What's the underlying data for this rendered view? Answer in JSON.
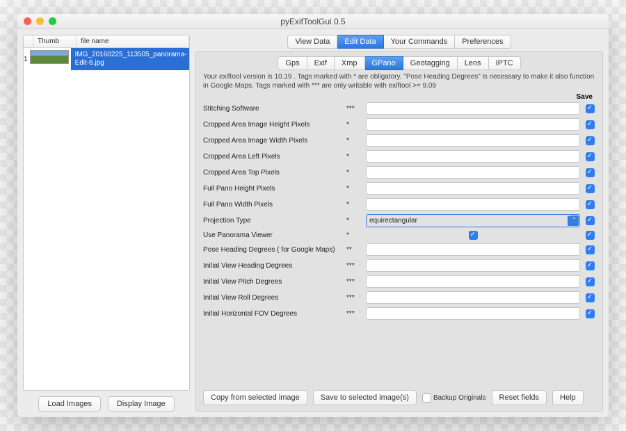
{
  "window": {
    "title": "pyExifToolGui 0.5"
  },
  "filelist": {
    "headers": {
      "thumb": "Thumb",
      "filename": "file name"
    },
    "rows": [
      {
        "index": "1",
        "filename": "IMG_20160225_113505_panorama-Edit-6.jpg"
      }
    ]
  },
  "left_buttons": {
    "load": "Load Images",
    "display": "Display Image"
  },
  "main_tabs": [
    "View Data",
    "Edit Data",
    "Your Commands",
    "Preferences"
  ],
  "main_tab_active": 1,
  "sub_tabs": [
    "Gps",
    "Exif",
    "Xmp",
    "GPano",
    "Geotagging",
    "Lens",
    "IPTC"
  ],
  "sub_tab_active": 3,
  "info_text": "Your exiftool version is 10.19 . Tags marked with * are obligatory. \"Pose Heading Degrees\" is necessary to make it also function in Google Maps. Tags marked with *** are only writable with exiftool >= 9.09",
  "save_header": "Save",
  "fields": [
    {
      "label": "Stitching Software",
      "ast": "***",
      "type": "text",
      "value": "",
      "save": true
    },
    {
      "label": "Cropped Area Image Height Pixels",
      "ast": "*",
      "type": "text",
      "value": "",
      "save": true
    },
    {
      "label": "Cropped Area Image Width Pixels",
      "ast": "*",
      "type": "text",
      "value": "",
      "save": true
    },
    {
      "label": "Cropped Area Left Pixels",
      "ast": "*",
      "type": "text",
      "value": "",
      "save": true
    },
    {
      "label": "Cropped Area Top Pixels",
      "ast": "*",
      "type": "text",
      "value": "",
      "save": true
    },
    {
      "label": "Full Pano Height Pixels",
      "ast": "*",
      "type": "text",
      "value": "",
      "save": true
    },
    {
      "label": "Full Pano Width Pixels",
      "ast": "*",
      "type": "text",
      "value": "",
      "save": true
    },
    {
      "label": "Projection Type",
      "ast": "*",
      "type": "select",
      "value": "equirectangular",
      "save": true
    },
    {
      "label": "Use Panorama Viewer",
      "ast": "*",
      "type": "check",
      "checked": true,
      "save": true
    },
    {
      "label": "Pose Heading Degrees ( for Google Maps)",
      "ast": "**",
      "type": "text",
      "value": "",
      "save": true
    },
    {
      "label": "Initial View Heading Degrees",
      "ast": "***",
      "type": "text",
      "value": "",
      "save": true
    },
    {
      "label": "Initial View Pitch Degrees",
      "ast": "***",
      "type": "text",
      "value": "",
      "save": true
    },
    {
      "label": "Initial View Roll Degrees",
      "ast": "***",
      "type": "text",
      "value": "",
      "save": true
    },
    {
      "label": "Initial Horizontal FOV Degrees",
      "ast": "***",
      "type": "text",
      "value": "",
      "save": true
    }
  ],
  "bottom": {
    "copy": "Copy from selected image",
    "save": "Save to selected image(s)",
    "backup": "Backup Originals",
    "reset": "Reset fields",
    "help": "Help"
  }
}
